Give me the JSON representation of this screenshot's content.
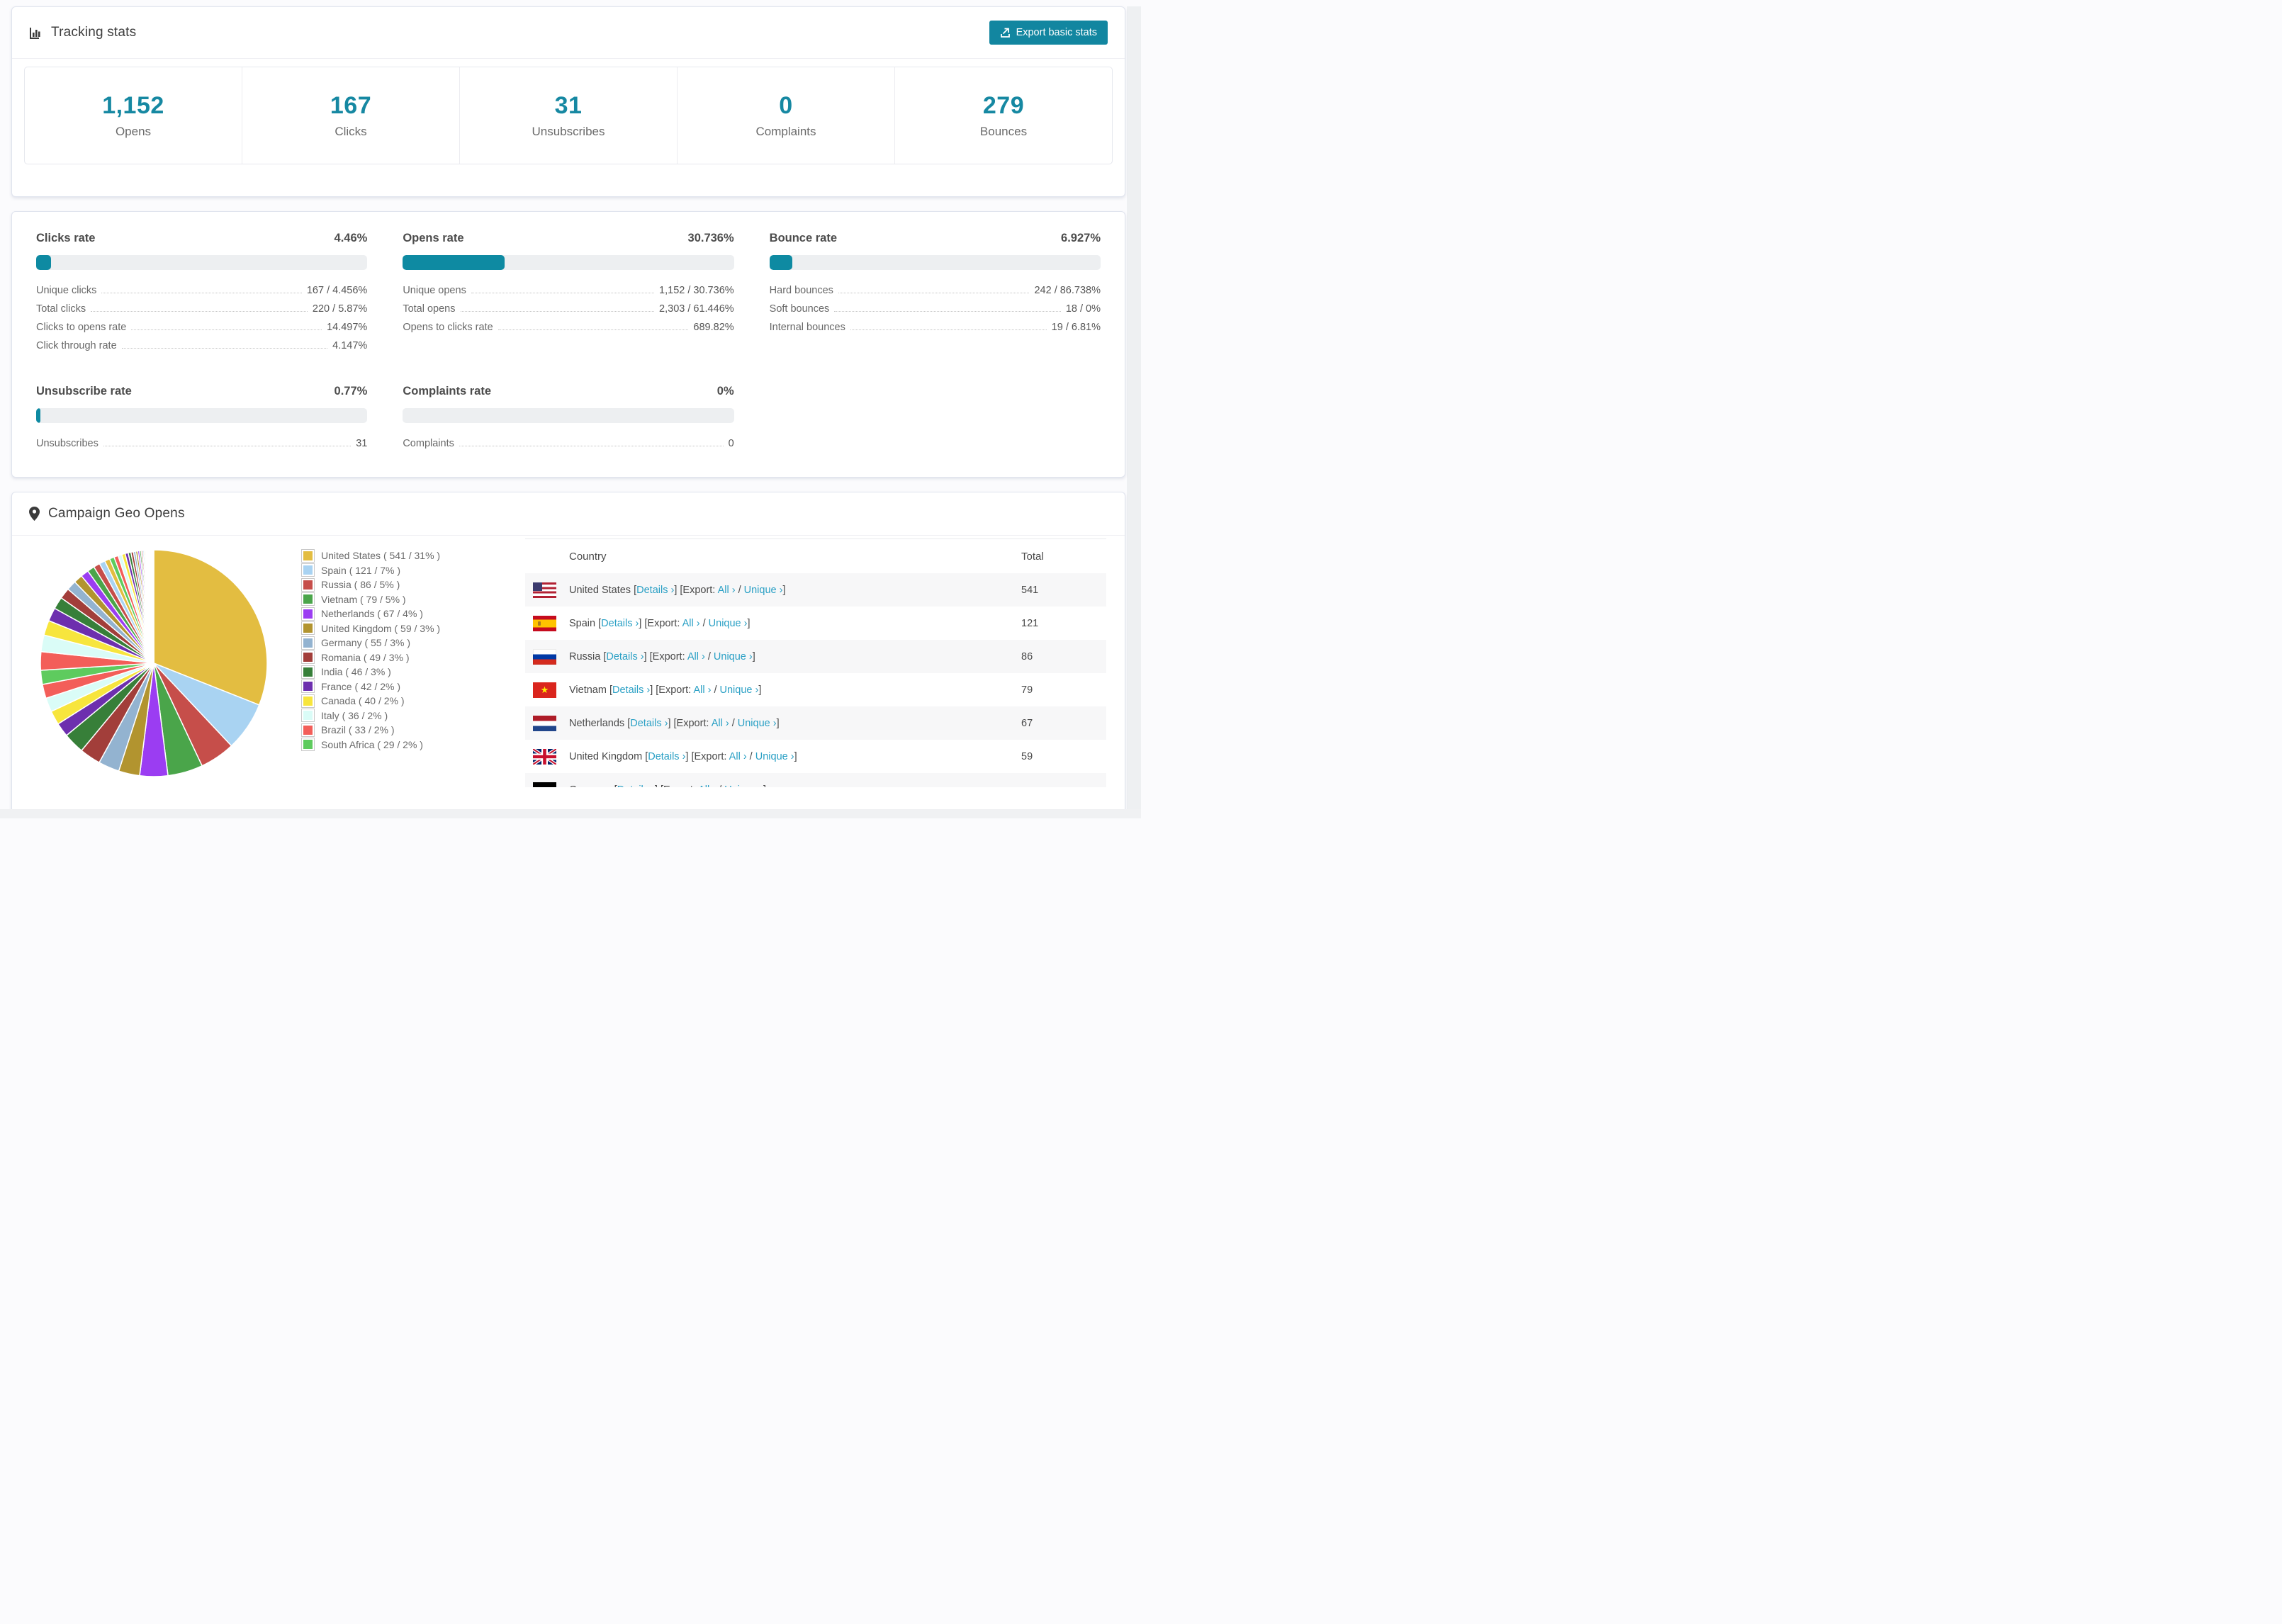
{
  "colors": {
    "accent_teal": "#1286a0",
    "number_teal": "#1688a2",
    "link_blue": "#2aa0c5",
    "bar_fill": "#0e8aa2",
    "bar_track": "#edeff1",
    "row_stripe": "#f7f7f8"
  },
  "tracking": {
    "title": "Tracking stats",
    "export_button_label": "Export basic stats",
    "stats": [
      {
        "value": "1,152",
        "label": "Opens"
      },
      {
        "value": "167",
        "label": "Clicks"
      },
      {
        "value": "31",
        "label": "Unsubscribes"
      },
      {
        "value": "0",
        "label": "Complaints"
      },
      {
        "value": "279",
        "label": "Bounces"
      }
    ]
  },
  "rates": {
    "panels": [
      {
        "id": "clicks-rate",
        "title": "Clicks rate",
        "value": "4.46%",
        "pct": 4.46,
        "rows": [
          {
            "label": "Unique clicks",
            "value": "167 / 4.456%"
          },
          {
            "label": "Total clicks",
            "value": "220 / 5.87%"
          },
          {
            "label": "Clicks to opens rate",
            "value": "14.497%"
          },
          {
            "label": "Click through rate",
            "value": "4.147%"
          }
        ]
      },
      {
        "id": "opens-rate",
        "title": "Opens rate",
        "value": "30.736%",
        "pct": 30.736,
        "rows": [
          {
            "label": "Unique opens",
            "value": "1,152 / 30.736%"
          },
          {
            "label": "Total opens",
            "value": "2,303 / 61.446%"
          },
          {
            "label": "Opens to clicks rate",
            "value": "689.82%"
          }
        ]
      },
      {
        "id": "bounce-rate",
        "title": "Bounce rate",
        "value": "6.927%",
        "pct": 6.927,
        "rows": [
          {
            "label": "Hard bounces",
            "value": "242 / 86.738%"
          },
          {
            "label": "Soft bounces",
            "value": "18 / 0%"
          },
          {
            "label": "Internal bounces",
            "value": "19 / 6.81%"
          }
        ]
      },
      {
        "id": "unsubscribe-rate",
        "title": "Unsubscribe rate",
        "value": "0.77%",
        "pct": 0.77,
        "rows": [
          {
            "label": "Unsubscribes",
            "value": "31"
          }
        ]
      },
      {
        "id": "complaints-rate",
        "title": "Complaints rate",
        "value": "0%",
        "pct": 0,
        "rows": [
          {
            "label": "Complaints",
            "value": "0"
          }
        ]
      }
    ]
  },
  "geo": {
    "title": "Campaign Geo Opens",
    "table": {
      "columns": [
        "Country",
        "Total"
      ],
      "link_details": "Details ›",
      "export_prefix": "Export:",
      "link_all": "All ›",
      "link_unique": "Unique ›",
      "rows": [
        {
          "country": "United States",
          "flag": "us",
          "total": "541",
          "partial": false
        },
        {
          "country": "Spain",
          "flag": "es",
          "total": "121",
          "partial": false
        },
        {
          "country": "Russia",
          "flag": "ru",
          "total": "86",
          "partial": false
        },
        {
          "country": "Vietnam",
          "flag": "vn",
          "total": "79",
          "partial": false
        },
        {
          "country": "Netherlands",
          "flag": "nl",
          "total": "67",
          "partial": false
        },
        {
          "country": "United Kingdom",
          "flag": "gb",
          "total": "59",
          "partial": false
        },
        {
          "country": "Germany",
          "flag": "de",
          "total": "",
          "partial": true
        }
      ]
    }
  },
  "chart_data": {
    "type": "pie",
    "title": "Campaign Geo Opens",
    "unit": "opens",
    "start_angle_deg": 0,
    "direction": "clockwise",
    "legend_position": "right",
    "slices": [
      {
        "label": "United States",
        "value": 541,
        "pct": 31,
        "color": "#e3bd41"
      },
      {
        "label": "Spain",
        "value": 121,
        "pct": 7,
        "color": "#a9d3f2"
      },
      {
        "label": "Russia",
        "value": 86,
        "pct": 5,
        "color": "#c64e4a"
      },
      {
        "label": "Vietnam",
        "value": 79,
        "pct": 5,
        "color": "#4aa54a"
      },
      {
        "label": "Netherlands",
        "value": 67,
        "pct": 4,
        "color": "#9b3df2"
      },
      {
        "label": "United Kingdom",
        "value": 59,
        "pct": 3,
        "color": "#b2942f"
      },
      {
        "label": "Germany",
        "value": 55,
        "pct": 3,
        "color": "#93b3d0"
      },
      {
        "label": "Romania",
        "value": 49,
        "pct": 3,
        "color": "#a23e3a"
      },
      {
        "label": "India",
        "value": 46,
        "pct": 3,
        "color": "#377f39"
      },
      {
        "label": "France",
        "value": 42,
        "pct": 2,
        "color": "#6d2fae"
      },
      {
        "label": "Canada",
        "value": 40,
        "pct": 2,
        "color": "#f7e53d"
      },
      {
        "label": "Italy",
        "value": 36,
        "pct": 2,
        "color": "#dafcf7"
      },
      {
        "label": "Brazil",
        "value": 33,
        "pct": 2,
        "color": "#f35e59"
      },
      {
        "label": "South Africa",
        "value": 29,
        "pct": 2,
        "color": "#5ecb5e"
      }
    ],
    "others": {
      "pct": 26,
      "label": "Remaining smaller countries (thin unlabeled slices)",
      "slice_count": 42,
      "decay": 0.9
    },
    "legend_format": "{label} ( {value} / {pct}% )"
  }
}
